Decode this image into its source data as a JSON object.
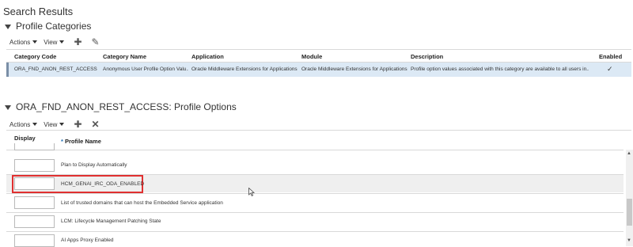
{
  "page": {
    "title": "Search Results"
  },
  "categories": {
    "section_title": "Profile Categories",
    "toolbar": {
      "actions": "Actions",
      "view": "View"
    },
    "columns": [
      "Category Code",
      "Category Name",
      "Application",
      "Module",
      "Description",
      "Enabled"
    ],
    "rows": [
      {
        "code": "ORA_FND_ANON_REST_ACCESS",
        "name": "Anonymous User Profile Option Valu...",
        "application": "Oracle Middleware Extensions for Applications",
        "module": "Oracle Middleware Extensions for Applications",
        "description": "Profile option values associated with this category are available to all users in...",
        "enabled": "✓"
      }
    ]
  },
  "options": {
    "section_title": "ORA_FND_ANON_REST_ACCESS: Profile Options",
    "toolbar": {
      "actions": "Actions",
      "view": "View"
    },
    "columns": {
      "display_sequence": "Display Sequence",
      "required_marker": "*",
      "profile_name": "Profile Name"
    },
    "rows": [
      {
        "sequence": "",
        "name": "Plan to Display Automatically"
      },
      {
        "sequence": "",
        "name": "HCM_GENAI_IRC_ODA_ENABLED"
      },
      {
        "sequence": "",
        "name": "List of trusted domains that can host the Embedded Service application"
      },
      {
        "sequence": "",
        "name": "LCM: Lifecycle Management Patching State"
      },
      {
        "sequence": "",
        "name": "AI Apps Proxy Enabled"
      }
    ]
  },
  "colors": {
    "highlight": "#e03030",
    "selected_row": "#dce9f5"
  }
}
